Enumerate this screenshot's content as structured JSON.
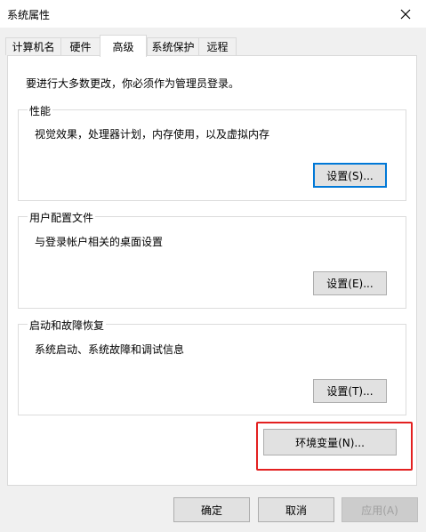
{
  "window": {
    "title": "系统属性"
  },
  "tabs": [
    {
      "label": "计算机名"
    },
    {
      "label": "硬件"
    },
    {
      "label": "高级"
    },
    {
      "label": "系统保护"
    },
    {
      "label": "远程"
    }
  ],
  "main": {
    "intro": "要进行大多数更改，你必须作为管理员登录。",
    "performance": {
      "title": "性能",
      "desc": "视觉效果，处理器计划，内存使用，以及虚拟内存",
      "button": "设置(S)..."
    },
    "profiles": {
      "title": "用户配置文件",
      "desc": "与登录帐户相关的桌面设置",
      "button": "设置(E)..."
    },
    "startup": {
      "title": "启动和故障恢复",
      "desc": "系统启动、系统故障和调试信息",
      "button": "设置(T)..."
    },
    "env_button": "环境变量(N)..."
  },
  "footer": {
    "ok": "确定",
    "cancel": "取消",
    "apply": "应用(A)"
  },
  "colors": {
    "focus": "#0078d7",
    "highlight": "#e32020"
  }
}
